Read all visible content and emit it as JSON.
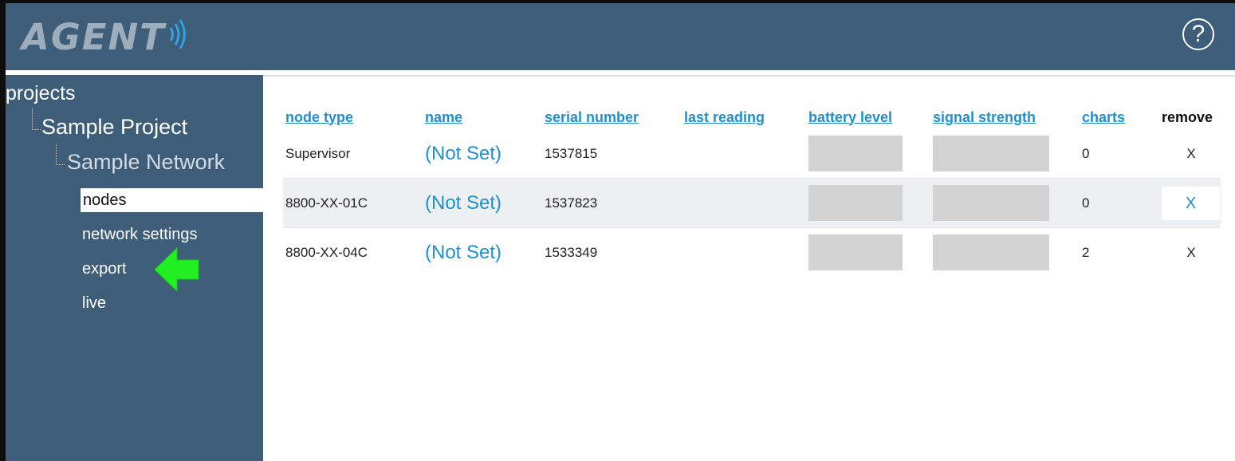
{
  "header": {
    "logo_text": "AGENT",
    "help_label": "?"
  },
  "sidebar": {
    "root": "projects",
    "project": "Sample Project",
    "network": "Sample Network",
    "items": [
      {
        "label": "nodes",
        "active": true
      },
      {
        "label": "network settings",
        "active": false
      },
      {
        "label": "export",
        "active": false
      },
      {
        "label": "live",
        "active": false
      }
    ]
  },
  "table": {
    "columns": [
      "node type",
      "name",
      "serial number",
      "last reading",
      "battery level",
      "signal strength",
      "charts",
      "remove"
    ],
    "rows": [
      {
        "node_type": "Supervisor",
        "name": "(Not Set)",
        "serial": "1537815",
        "last_reading": "",
        "charts": "0",
        "remove": "X"
      },
      {
        "node_type": "8800-XX-01C",
        "name": "(Not Set)",
        "serial": "1537823",
        "last_reading": "",
        "charts": "0",
        "remove": "X"
      },
      {
        "node_type": "8800-XX-04C",
        "name": "(Not Set)",
        "serial": "1533349",
        "last_reading": "",
        "charts": "2",
        "remove": "X"
      }
    ]
  },
  "colors": {
    "header_bg": "#3e5d79",
    "link_blue": "#1e90d0",
    "arrow_green": "#22ee22",
    "placeholder_gray": "#d3d3d3"
  },
  "icons": [
    "signal-waves-icon",
    "help-icon",
    "green-arrow-icon"
  ]
}
